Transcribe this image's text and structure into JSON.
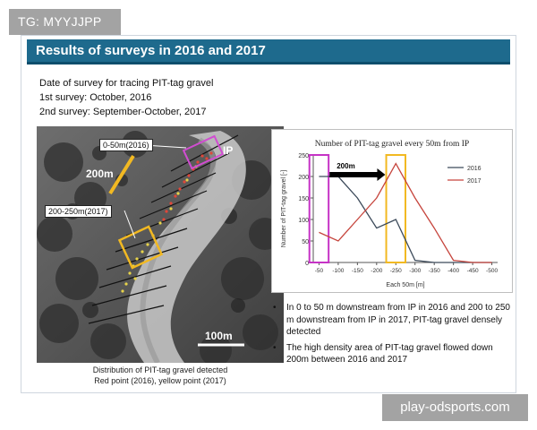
{
  "tag": "TG: MYYJJPP",
  "slide_title": "Results of surveys in 2016 and 2017",
  "survey_lines": [
    "Date of survey for tracing PIT-tag gravel",
    "1st survey: October, 2016",
    "2nd survey: September-October, 2017"
  ],
  "photo": {
    "label_2016": "0-50m(2016)",
    "label_2017": "200-250m(2017)",
    "ip_label": "IP",
    "distance_label": "200m",
    "scale_label": "100m",
    "caption_line1": "Distribution of PIT-tag gravel detected",
    "caption_line2": "Red point (2016), yellow point (2017)"
  },
  "chart_data": {
    "type": "line",
    "title": "Number of PIT-tag gravel every 50m from IP",
    "xlabel": "Each 50m [m]",
    "ylabel": "Number of PIT-tag gravel [-]",
    "categories": [
      "-50",
      "-100",
      "-150",
      "-200",
      "-250",
      "-300",
      "-350",
      "-400",
      "-450",
      "-500"
    ],
    "yticks": [
      "0",
      "50",
      "100",
      "150",
      "200",
      "250"
    ],
    "ylim": [
      0,
      250
    ],
    "series": [
      {
        "name": "2016",
        "color": "#3c4a5a",
        "values": [
          200,
          200,
          150,
          80,
          100,
          5,
          0,
          0,
          0,
          0
        ]
      },
      {
        "name": "2017",
        "color": "#c6453d",
        "values": [
          70,
          50,
          100,
          150,
          230,
          150,
          80,
          5,
          0,
          0
        ]
      }
    ],
    "annotation": "200m",
    "legend_position": "top-right",
    "highlights": [
      {
        "name": "2016-zone",
        "color": "#c633c6",
        "x_from": "-50",
        "x_to": "-50"
      },
      {
        "name": "2017-zone",
        "color": "#f2b922",
        "x_from": "-250",
        "x_to": "-250"
      }
    ]
  },
  "bullets": [
    "In 0 to 50 m downstream from IP in 2016 and 200 to 250 m downstream from IP in 2017, PIT-tag gravel densely detected",
    "The high density area of PIT-tag gravel flowed down 200m between 2016 and 2017"
  ],
  "bullet_symbol": "•",
  "watermark": "play-odsports.com"
}
